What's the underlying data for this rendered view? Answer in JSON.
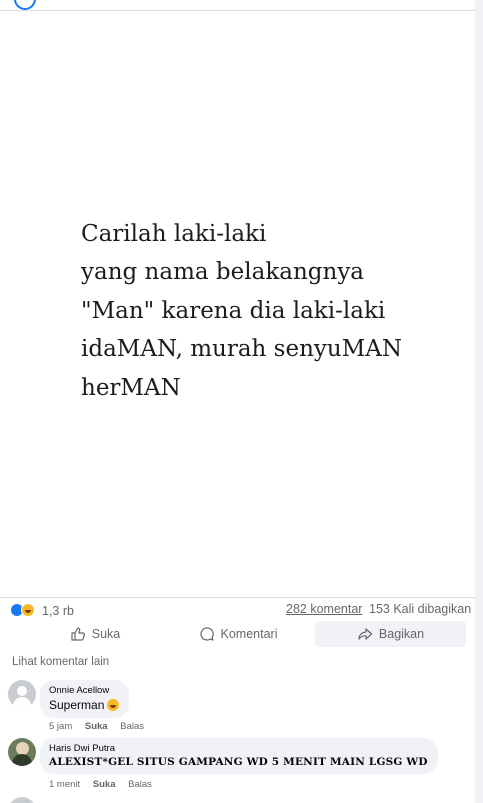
{
  "post": {
    "image_text": {
      "line1": "Carilah laki-laki",
      "line2": "yang nama belakangnya",
      "line3": "\"Man\" karena dia laki-laki",
      "line4": "idaMAN, murah senyuMAN",
      "line5": "herMAN"
    },
    "stats": {
      "reaction_count": "1,3 rb",
      "comments": "282 komentar",
      "shares": "153 Kali dibagikan"
    },
    "actions": {
      "like": "Suka",
      "comment": "Komentari",
      "share": "Bagikan"
    }
  },
  "comments_section": {
    "see_more": "Lihat komentar lain",
    "comments": [
      {
        "author": "Onnie Acellow",
        "text": "Superman",
        "emoji": "laughing-emoji",
        "time": "5 jam",
        "like": "Suka",
        "reply": "Balas"
      },
      {
        "author": "Haris Dwi Putra",
        "text": "ALEXIST*GEL SITUS GAMPANG WD 5 MENIT MAIN LGSG WD",
        "time": "1 menit",
        "like": "Suka",
        "reply": "Balas"
      }
    ]
  },
  "colors": {
    "brand_blue": "#1877f2",
    "secondary_text": "#65676b",
    "bubble_bg": "#f0f2f5"
  }
}
